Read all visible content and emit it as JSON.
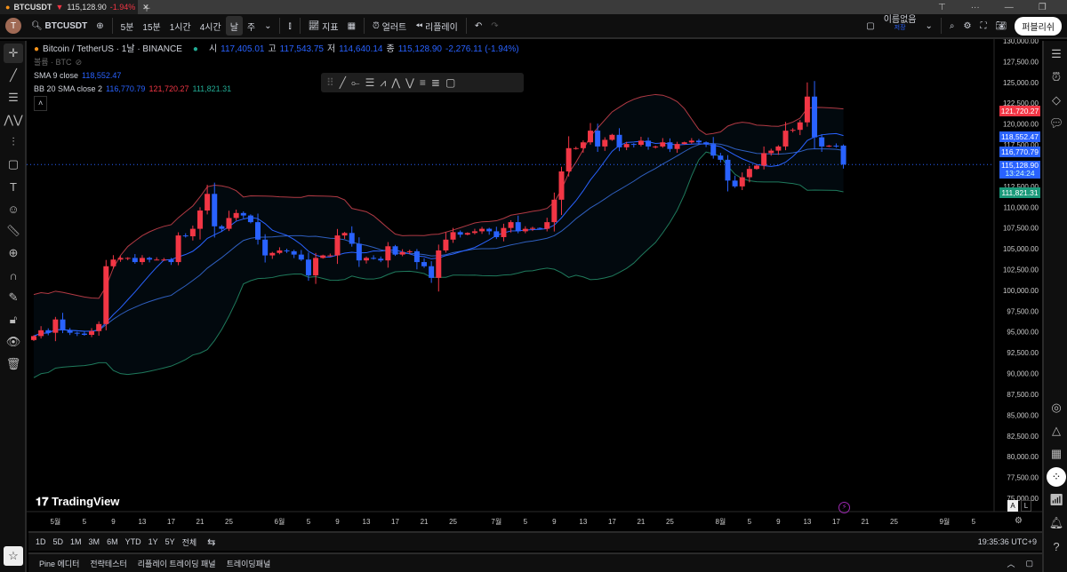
{
  "tab": {
    "symbol": "BTCUSDT",
    "price": "115,128.90",
    "change": "-1.94%"
  },
  "toolbar": {
    "avatar": "T",
    "symbol": "BTCUSDT",
    "intervals": [
      "5분",
      "15분",
      "1시간",
      "4시간",
      "날",
      "주"
    ],
    "active_interval": "날",
    "indicators": "지표",
    "alert": "얼러트",
    "replay": "리플레이",
    "layout_name": "이름없음",
    "layout_saved": "저장",
    "publish": "퍼블리쉬"
  },
  "legend": {
    "title": "Bitcoin / TetherUS · 1날 · BINANCE",
    "o_label": "시",
    "o": "117,405.01",
    "h_label": "고",
    "h": "117,543.75",
    "l_label": "저",
    "l": "114,640.14",
    "c_label": "종",
    "c": "115,128.90",
    "chg": "-2,276.11 (-1.94%)",
    "volume": "볼륨 · BTC",
    "sma_label": "SMA 9 close",
    "sma": "118,552.47",
    "bb_label": "BB 20 SMA close 2",
    "bb_basis": "116,770.79",
    "bb_upper": "121,720.27",
    "bb_lower": "111,821.31"
  },
  "price_tags": {
    "upper": "121,720.27",
    "sma": "118,552.47",
    "basis": "116,770.79",
    "last": "115,128.90",
    "countdown": "13:24:24",
    "lower": "111,821.31"
  },
  "colors": {
    "up": "#f23645",
    "down": "#2962ff",
    "upper": "#b23a44",
    "lower": "#1f7a5c",
    "sma": "#2962ff",
    "basis": "#2f5fbf"
  },
  "brand": "TradingView",
  "auto_btn": "A",
  "log_btn": "L",
  "ranges": [
    "1D",
    "5D",
    "1M",
    "3M",
    "6M",
    "YTD",
    "1Y",
    "5Y",
    "전체"
  ],
  "clock": "19:35:36 UTC+9",
  "bottom_tabs": [
    "Pine 에디터",
    "전략테스터",
    "리플레이 트레이딩 패널",
    "트레이딩패널"
  ],
  "chart_data": {
    "type": "candlestick",
    "start_date": "2025-04-28",
    "last_ohlc": [
      117405.01,
      117543.75,
      114640.14,
      115128.9
    ],
    "closes": [
      94500,
      95200,
      94900,
      96500,
      95200,
      94900,
      94800,
      94650,
      95100,
      95950,
      102900,
      103700,
      103900,
      103900,
      103400,
      103900,
      103700,
      103700,
      103700,
      103400,
      106600,
      106500,
      107400,
      109600,
      111600,
      107700,
      107400,
      108700,
      109300,
      109000,
      108200,
      106100,
      104200,
      104500,
      104800,
      104700,
      104300,
      103700,
      101800,
      103900,
      104200,
      104200,
      106600,
      106900,
      105600,
      103600,
      103900,
      103800,
      103600,
      105300,
      104300,
      104600,
      104700,
      103400,
      102900,
      101500,
      104800,
      106100,
      107000,
      106700,
      106900,
      107100,
      107400,
      107100,
      106400,
      107500,
      108200,
      107100,
      107400,
      107500,
      107400,
      108200,
      110900,
      114300,
      117100,
      117100,
      117800,
      119200,
      117300,
      118100,
      118700,
      117200,
      117600,
      117500,
      118000,
      117300,
      117300,
      117800,
      117000,
      117600,
      117800,
      118000,
      117800,
      117600,
      116200,
      115700,
      113200,
      112500,
      113600,
      114600,
      115000,
      116500,
      116800,
      117300,
      119200,
      119300,
      120200,
      123300,
      118400,
      117300,
      117400,
      117300,
      115128.9
    ],
    "y_ticks": [
      "130,000.00",
      "127,500.00",
      "125,000.00",
      "122,500.00",
      "120,000.00",
      "117,500.00",
      "115,000.00",
      "112,500.00",
      "110,000.00",
      "107,500.00",
      "105,000.00",
      "102,500.00",
      "100,000.00",
      "97,500.00",
      "95,000.00",
      "92,500.00",
      "90,000.00",
      "87,500.00",
      "85,000.00",
      "82,500.00",
      "80,000.00",
      "77,500.00",
      "75,000.00"
    ],
    "ylim": [
      75000,
      130000
    ],
    "x_ticks": [
      {
        "label": "5월",
        "day": 3
      },
      {
        "label": "5",
        "day": 7
      },
      {
        "label": "9",
        "day": 11
      },
      {
        "label": "13",
        "day": 15
      },
      {
        "label": "17",
        "day": 19
      },
      {
        "label": "21",
        "day": 23
      },
      {
        "label": "25",
        "day": 27
      },
      {
        "label": "6월",
        "day": 34
      },
      {
        "label": "5",
        "day": 38
      },
      {
        "label": "9",
        "day": 42
      },
      {
        "label": "13",
        "day": 46
      },
      {
        "label": "17",
        "day": 50
      },
      {
        "label": "21",
        "day": 54
      },
      {
        "label": "25",
        "day": 58
      },
      {
        "label": "7월",
        "day": 64
      },
      {
        "label": "5",
        "day": 68
      },
      {
        "label": "9",
        "day": 72
      },
      {
        "label": "13",
        "day": 76
      },
      {
        "label": "17",
        "day": 80
      },
      {
        "label": "21",
        "day": 84
      },
      {
        "label": "25",
        "day": 88
      },
      {
        "label": "8월",
        "day": 95
      },
      {
        "label": "5",
        "day": 99
      },
      {
        "label": "9",
        "day": 103
      },
      {
        "label": "13",
        "day": 107
      },
      {
        "label": "17",
        "day": 111
      },
      {
        "label": "21",
        "day": 115
      },
      {
        "label": "25",
        "day": 119
      },
      {
        "label": "9월",
        "day": 126
      },
      {
        "label": "5",
        "day": 130
      }
    ],
    "indicators": [
      {
        "name": "SMA",
        "length": 9
      },
      {
        "name": "BB",
        "length": 20,
        "mult": 2
      }
    ]
  }
}
